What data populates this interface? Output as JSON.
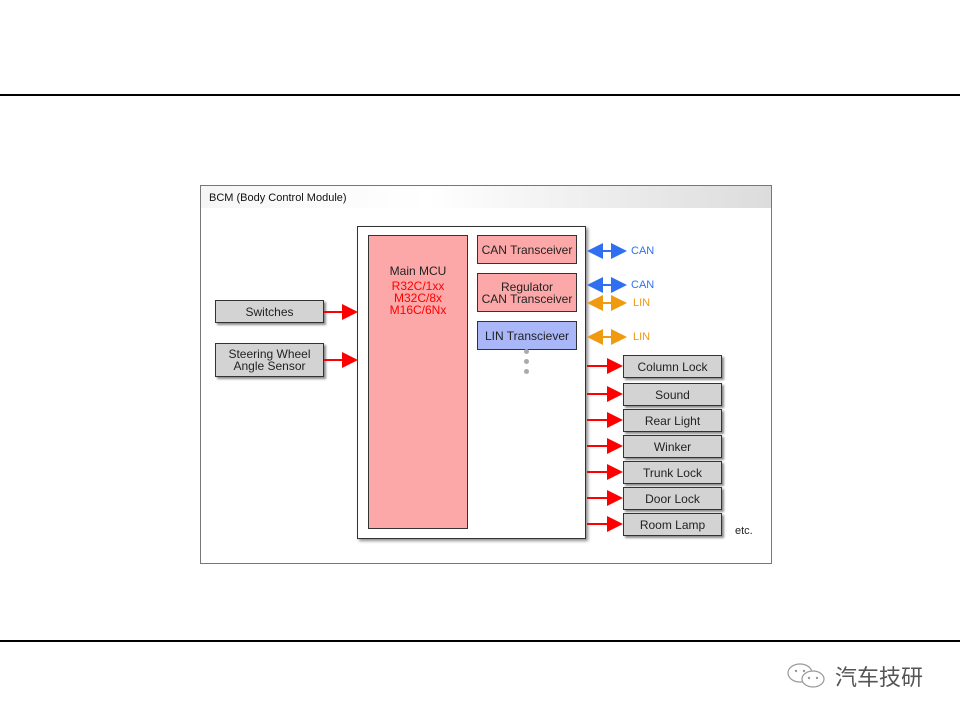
{
  "frame_title": "BCM (Body Control Module)",
  "mcu": {
    "title": "Main MCU",
    "models": [
      "R32C/1xx",
      "M32C/8x",
      "M16C/6Nx"
    ]
  },
  "transceivers": {
    "can": "CAN Transceiver",
    "regulator_line1": "Regulator",
    "regulator_line2": "CAN Transceiver",
    "lin": "LIN Transciever"
  },
  "inputs": {
    "switches": "Switches",
    "steering_line1": "Steering Wheel",
    "steering_line2": "Angle Sensor"
  },
  "bus_labels": [
    "CAN",
    "CAN",
    "LIN",
    "LIN"
  ],
  "outputs": [
    "Column Lock",
    "Sound",
    "Rear Light",
    "Winker",
    "Trunk Lock",
    "Door Lock",
    "Room Lamp"
  ],
  "etc": "etc.",
  "watermark": "汽车技研",
  "colors": {
    "can": "#3070f0",
    "lin": "#f09a10",
    "signal": "#ff0000"
  }
}
